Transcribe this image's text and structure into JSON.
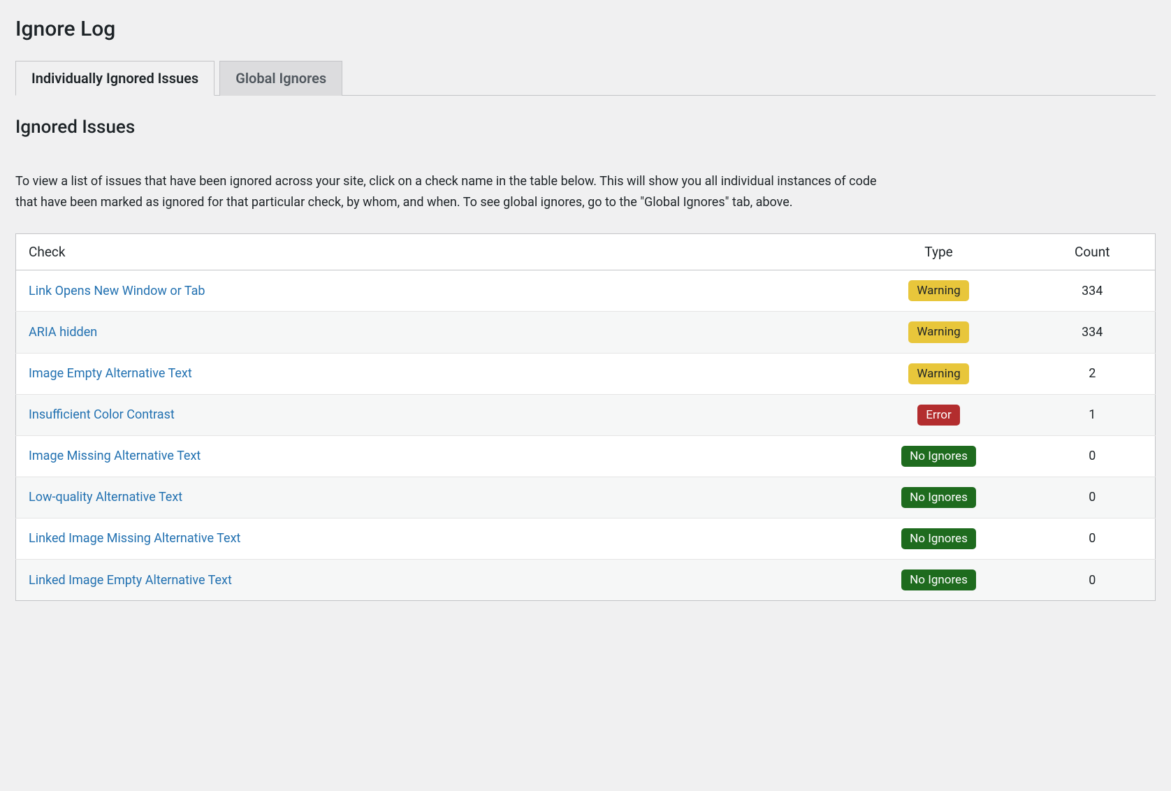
{
  "page_title": "Ignore Log",
  "tabs": {
    "individual": "Individually Ignored Issues",
    "global": "Global Ignores"
  },
  "section_title": "Ignored Issues",
  "description": "To view a list of issues that have been ignored across your site, click on a check name in the table below. This will show you all individual instances of code that have been marked as ignored for that particular check, by whom, and when. To see global ignores, go to the \"Global Ignores\" tab, above.",
  "table": {
    "headers": {
      "check": "Check",
      "type": "Type",
      "count": "Count"
    },
    "rows": [
      {
        "check": "Link Opens New Window or Tab",
        "type": "Warning",
        "type_class": "warning",
        "count": "334"
      },
      {
        "check": "ARIA hidden",
        "type": "Warning",
        "type_class": "warning",
        "count": "334"
      },
      {
        "check": "Image Empty Alternative Text",
        "type": "Warning",
        "type_class": "warning",
        "count": "2"
      },
      {
        "check": "Insufficient Color Contrast",
        "type": "Error",
        "type_class": "error",
        "count": "1"
      },
      {
        "check": "Image Missing Alternative Text",
        "type": "No Ignores",
        "type_class": "noignores",
        "count": "0"
      },
      {
        "check": "Low-quality Alternative Text",
        "type": "No Ignores",
        "type_class": "noignores",
        "count": "0"
      },
      {
        "check": "Linked Image Missing Alternative Text",
        "type": "No Ignores",
        "type_class": "noignores",
        "count": "0"
      },
      {
        "check": "Linked Image Empty Alternative Text",
        "type": "No Ignores",
        "type_class": "noignores",
        "count": "0"
      }
    ]
  }
}
